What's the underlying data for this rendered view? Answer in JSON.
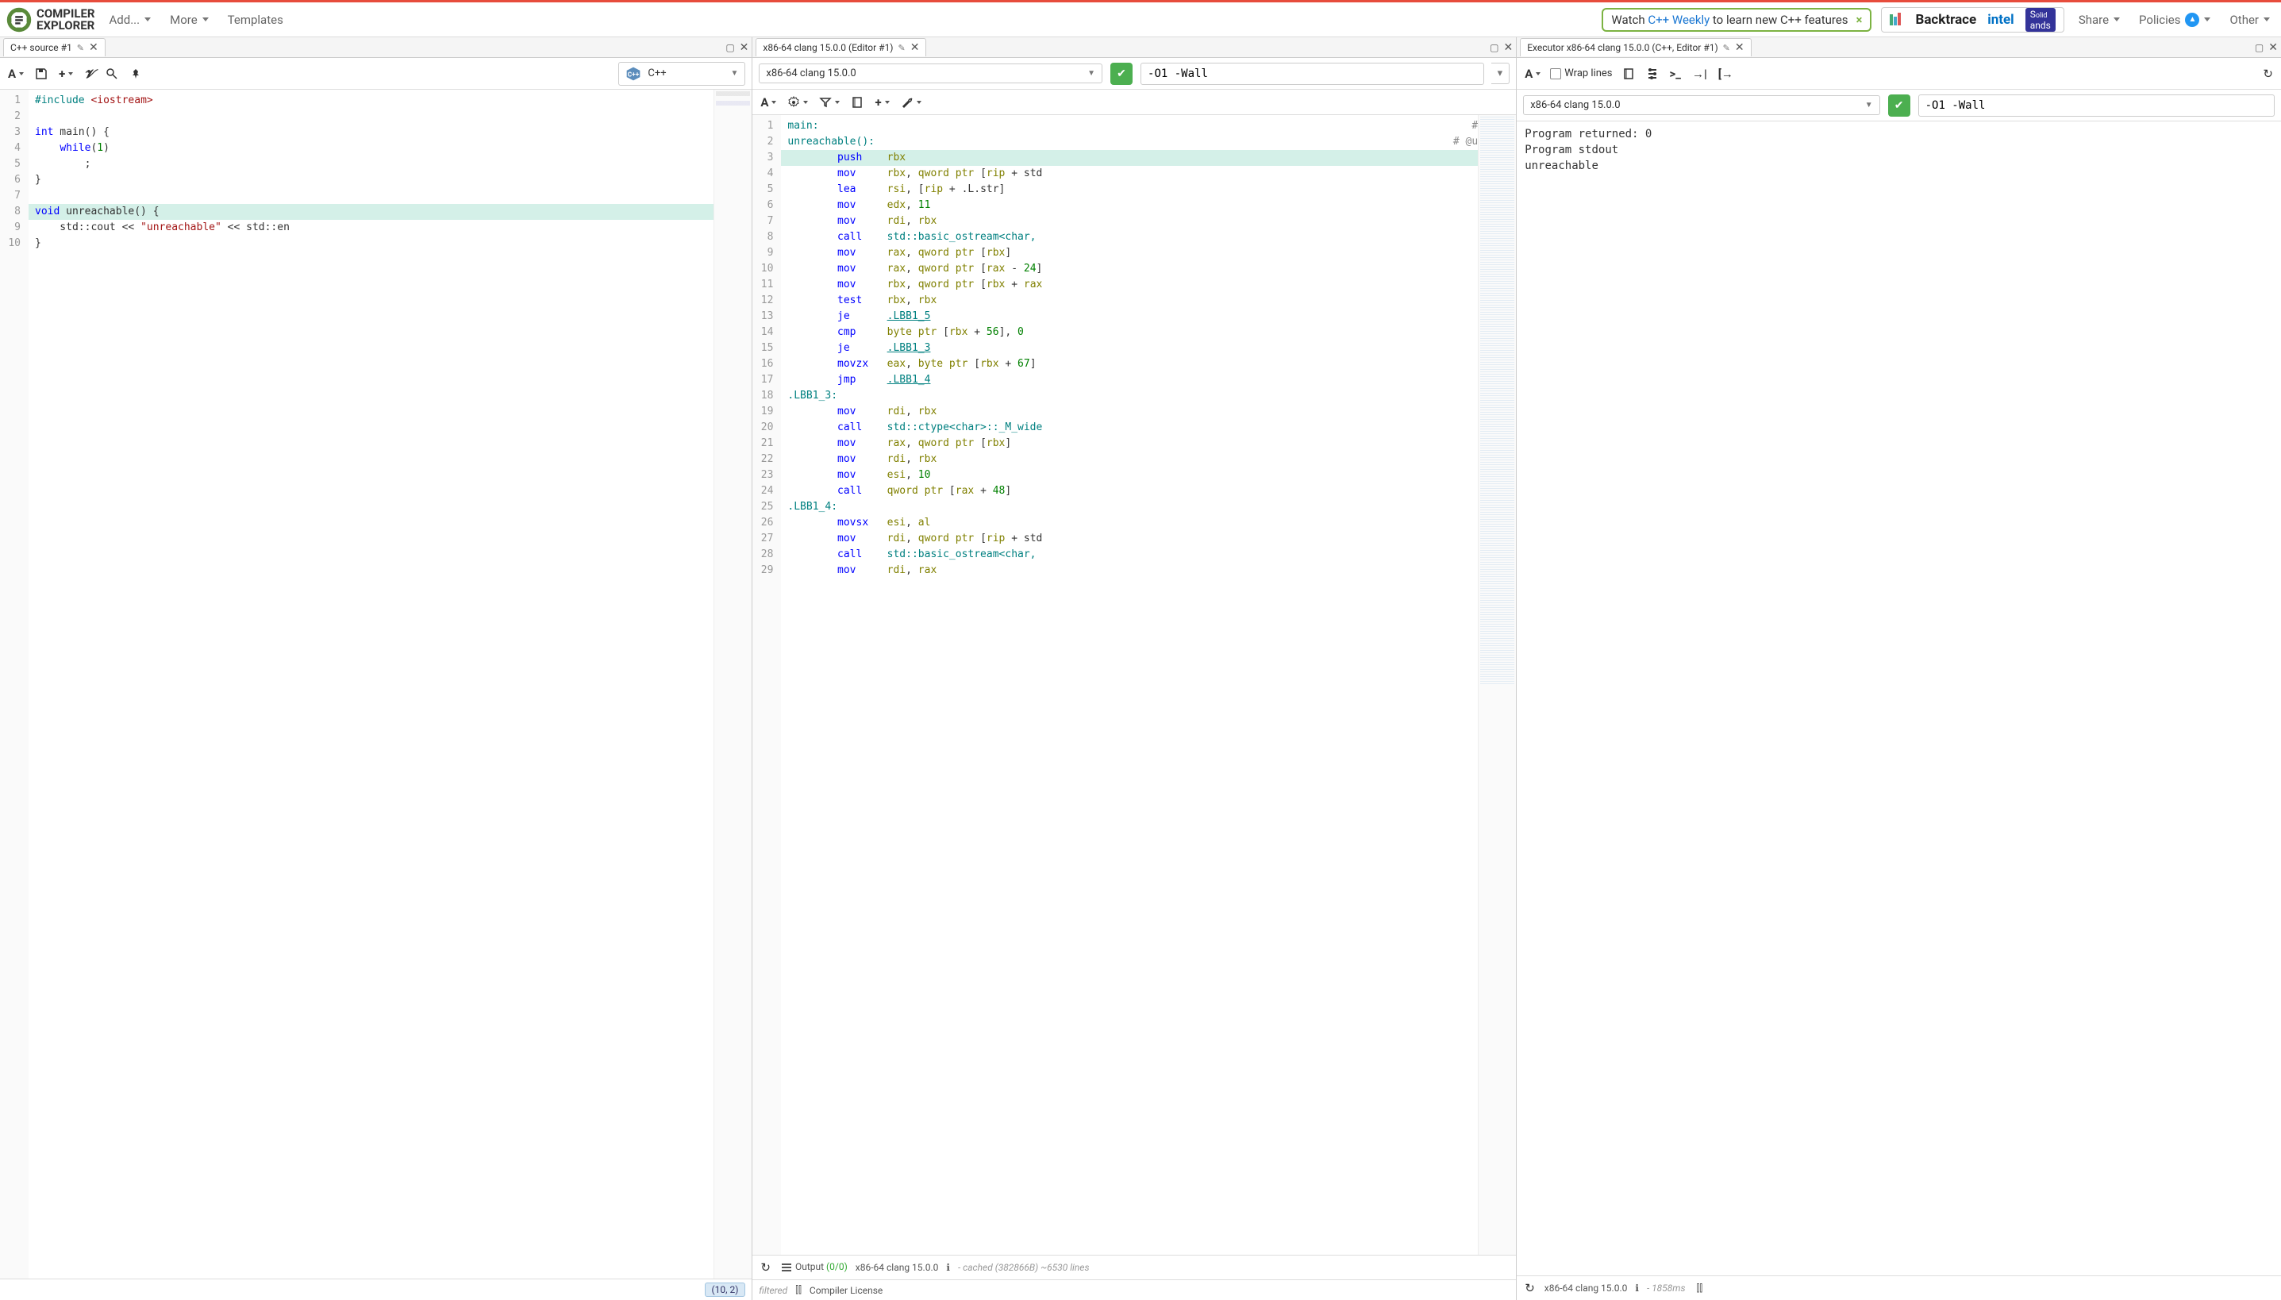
{
  "header": {
    "logo_top": "COMPILER",
    "logo_bot": "EXPLORER",
    "nav": {
      "add": "Add...",
      "more": "More",
      "templates": "Templates",
      "share": "Share",
      "policies": "Policies",
      "other": "Other"
    },
    "banner": {
      "prefix": "Watch ",
      "link": "C++ Weekly",
      "suffix": " to learn new C++ features"
    },
    "sponsors": {
      "backtrace": "Backtrace",
      "intel": "intel",
      "solidsands": "Solid Sands"
    }
  },
  "editor": {
    "tab": "C++ source #1",
    "lang_label": "C++",
    "cursor": "(10, 2)",
    "lines": [
      {
        "n": 1,
        "tokens": [
          {
            "t": "#include ",
            "c": "k-teal"
          },
          {
            "t": "<iostream>",
            "c": "k-str"
          }
        ]
      },
      {
        "n": 2,
        "tokens": []
      },
      {
        "n": 3,
        "tokens": [
          {
            "t": "int",
            "c": "k-blue"
          },
          {
            "t": " main() {",
            "c": ""
          }
        ]
      },
      {
        "n": 4,
        "tokens": [
          {
            "t": "    ",
            "c": ""
          },
          {
            "t": "while",
            "c": "k-blue"
          },
          {
            "t": "(",
            "c": ""
          },
          {
            "t": "1",
            "c": "k-green"
          },
          {
            "t": ")",
            "c": ""
          }
        ]
      },
      {
        "n": 5,
        "tokens": [
          {
            "t": "        ;",
            "c": ""
          }
        ]
      },
      {
        "n": 6,
        "tokens": [
          {
            "t": "}",
            "c": ""
          }
        ]
      },
      {
        "n": 7,
        "tokens": []
      },
      {
        "n": 8,
        "hl": true,
        "tokens": [
          {
            "t": "void",
            "c": "k-blue"
          },
          {
            "t": " unreachable() {",
            "c": ""
          }
        ]
      },
      {
        "n": 9,
        "tokens": [
          {
            "t": "    std::cout << ",
            "c": ""
          },
          {
            "t": "\"unreachable\"",
            "c": "k-str"
          },
          {
            "t": " << std::en",
            "c": ""
          }
        ]
      },
      {
        "n": 10,
        "tokens": [
          {
            "t": "}",
            "c": ""
          }
        ]
      }
    ]
  },
  "compiler": {
    "tab": "x86-64 clang 15.0.0 (Editor #1)",
    "compiler_label": "x86-64 clang 15.0.0",
    "opts": "-O1 -Wall",
    "asm": [
      {
        "n": 1,
        "ind": 0,
        "tokens": [
          {
            "t": "main:",
            "c": "k-teal"
          }
        ],
        "right": "#"
      },
      {
        "n": 2,
        "ind": 0,
        "tokens": [
          {
            "t": "unreachable():",
            "c": "k-teal"
          }
        ],
        "right": "# @u"
      },
      {
        "n": 3,
        "ind": 2,
        "hl": true,
        "tokens": [
          {
            "t": "push",
            "c": "k-blue"
          },
          {
            "t": "    ",
            "c": ""
          },
          {
            "t": "rbx",
            "c": "k-olive"
          }
        ]
      },
      {
        "n": 4,
        "ind": 2,
        "tokens": [
          {
            "t": "mov",
            "c": "k-blue"
          },
          {
            "t": "     ",
            "c": ""
          },
          {
            "t": "rbx",
            "c": "k-olive"
          },
          {
            "t": ", ",
            "c": ""
          },
          {
            "t": "qword ptr",
            "c": "k-olive"
          },
          {
            "t": " [",
            "c": ""
          },
          {
            "t": "rip",
            "c": "k-olive"
          },
          {
            "t": " + std",
            "c": ""
          }
        ]
      },
      {
        "n": 5,
        "ind": 2,
        "tokens": [
          {
            "t": "lea",
            "c": "k-blue"
          },
          {
            "t": "     ",
            "c": ""
          },
          {
            "t": "rsi",
            "c": "k-olive"
          },
          {
            "t": ", [",
            "c": ""
          },
          {
            "t": "rip",
            "c": "k-olive"
          },
          {
            "t": " + .L.str]",
            "c": ""
          }
        ]
      },
      {
        "n": 6,
        "ind": 2,
        "tokens": [
          {
            "t": "mov",
            "c": "k-blue"
          },
          {
            "t": "     ",
            "c": ""
          },
          {
            "t": "edx",
            "c": "k-olive"
          },
          {
            "t": ", ",
            "c": ""
          },
          {
            "t": "11",
            "c": "k-green"
          }
        ]
      },
      {
        "n": 7,
        "ind": 2,
        "tokens": [
          {
            "t": "mov",
            "c": "k-blue"
          },
          {
            "t": "     ",
            "c": ""
          },
          {
            "t": "rdi",
            "c": "k-olive"
          },
          {
            "t": ", ",
            "c": ""
          },
          {
            "t": "rbx",
            "c": "k-olive"
          }
        ]
      },
      {
        "n": 8,
        "ind": 2,
        "tokens": [
          {
            "t": "call",
            "c": "k-blue"
          },
          {
            "t": "    ",
            "c": ""
          },
          {
            "t": "std::basic_ostream<char, ",
            "c": "k-teal"
          }
        ]
      },
      {
        "n": 9,
        "ind": 2,
        "tokens": [
          {
            "t": "mov",
            "c": "k-blue"
          },
          {
            "t": "     ",
            "c": ""
          },
          {
            "t": "rax",
            "c": "k-olive"
          },
          {
            "t": ", ",
            "c": ""
          },
          {
            "t": "qword ptr",
            "c": "k-olive"
          },
          {
            "t": " [",
            "c": ""
          },
          {
            "t": "rbx",
            "c": "k-olive"
          },
          {
            "t": "]",
            "c": ""
          }
        ]
      },
      {
        "n": 10,
        "ind": 2,
        "tokens": [
          {
            "t": "mov",
            "c": "k-blue"
          },
          {
            "t": "     ",
            "c": ""
          },
          {
            "t": "rax",
            "c": "k-olive"
          },
          {
            "t": ", ",
            "c": ""
          },
          {
            "t": "qword ptr",
            "c": "k-olive"
          },
          {
            "t": " [",
            "c": ""
          },
          {
            "t": "rax",
            "c": "k-olive"
          },
          {
            "t": " - ",
            "c": ""
          },
          {
            "t": "24",
            "c": "k-green"
          },
          {
            "t": "]",
            "c": ""
          }
        ]
      },
      {
        "n": 11,
        "ind": 2,
        "tokens": [
          {
            "t": "mov",
            "c": "k-blue"
          },
          {
            "t": "     ",
            "c": ""
          },
          {
            "t": "rbx",
            "c": "k-olive"
          },
          {
            "t": ", ",
            "c": ""
          },
          {
            "t": "qword ptr",
            "c": "k-olive"
          },
          {
            "t": " [",
            "c": ""
          },
          {
            "t": "rbx",
            "c": "k-olive"
          },
          {
            "t": " + ",
            "c": ""
          },
          {
            "t": "rax",
            "c": "k-olive"
          }
        ]
      },
      {
        "n": 12,
        "ind": 2,
        "tokens": [
          {
            "t": "test",
            "c": "k-blue"
          },
          {
            "t": "    ",
            "c": ""
          },
          {
            "t": "rbx",
            "c": "k-olive"
          },
          {
            "t": ", ",
            "c": ""
          },
          {
            "t": "rbx",
            "c": "k-olive"
          }
        ]
      },
      {
        "n": 13,
        "ind": 2,
        "tokens": [
          {
            "t": "je",
            "c": "k-blue"
          },
          {
            "t": "      ",
            "c": ""
          },
          {
            "t": ".LBB1_5",
            "c": "k-teal k-und"
          }
        ]
      },
      {
        "n": 14,
        "ind": 2,
        "tokens": [
          {
            "t": "cmp",
            "c": "k-blue"
          },
          {
            "t": "     ",
            "c": ""
          },
          {
            "t": "byte ptr",
            "c": "k-olive"
          },
          {
            "t": " [",
            "c": ""
          },
          {
            "t": "rbx",
            "c": "k-olive"
          },
          {
            "t": " + ",
            "c": ""
          },
          {
            "t": "56",
            "c": "k-green"
          },
          {
            "t": "], ",
            "c": ""
          },
          {
            "t": "0",
            "c": "k-green"
          }
        ]
      },
      {
        "n": 15,
        "ind": 2,
        "tokens": [
          {
            "t": "je",
            "c": "k-blue"
          },
          {
            "t": "      ",
            "c": ""
          },
          {
            "t": ".LBB1_3",
            "c": "k-teal k-und"
          }
        ]
      },
      {
        "n": 16,
        "ind": 2,
        "tokens": [
          {
            "t": "movzx",
            "c": "k-blue"
          },
          {
            "t": "   ",
            "c": ""
          },
          {
            "t": "eax",
            "c": "k-olive"
          },
          {
            "t": ", ",
            "c": ""
          },
          {
            "t": "byte ptr",
            "c": "k-olive"
          },
          {
            "t": " [",
            "c": ""
          },
          {
            "t": "rbx",
            "c": "k-olive"
          },
          {
            "t": " + ",
            "c": ""
          },
          {
            "t": "67",
            "c": "k-green"
          },
          {
            "t": "]",
            "c": ""
          }
        ]
      },
      {
        "n": 17,
        "ind": 2,
        "tokens": [
          {
            "t": "jmp",
            "c": "k-blue"
          },
          {
            "t": "     ",
            "c": ""
          },
          {
            "t": ".LBB1_4",
            "c": "k-teal k-und"
          }
        ]
      },
      {
        "n": 18,
        "ind": 0,
        "tokens": [
          {
            "t": ".LBB1_3:",
            "c": "k-teal"
          }
        ]
      },
      {
        "n": 19,
        "ind": 2,
        "tokens": [
          {
            "t": "mov",
            "c": "k-blue"
          },
          {
            "t": "     ",
            "c": ""
          },
          {
            "t": "rdi",
            "c": "k-olive"
          },
          {
            "t": ", ",
            "c": ""
          },
          {
            "t": "rbx",
            "c": "k-olive"
          }
        ]
      },
      {
        "n": 20,
        "ind": 2,
        "tokens": [
          {
            "t": "call",
            "c": "k-blue"
          },
          {
            "t": "    ",
            "c": ""
          },
          {
            "t": "std::ctype<char>::_M_wide",
            "c": "k-teal"
          }
        ]
      },
      {
        "n": 21,
        "ind": 2,
        "tokens": [
          {
            "t": "mov",
            "c": "k-blue"
          },
          {
            "t": "     ",
            "c": ""
          },
          {
            "t": "rax",
            "c": "k-olive"
          },
          {
            "t": ", ",
            "c": ""
          },
          {
            "t": "qword ptr",
            "c": "k-olive"
          },
          {
            "t": " [",
            "c": ""
          },
          {
            "t": "rbx",
            "c": "k-olive"
          },
          {
            "t": "]",
            "c": ""
          }
        ]
      },
      {
        "n": 22,
        "ind": 2,
        "tokens": [
          {
            "t": "mov",
            "c": "k-blue"
          },
          {
            "t": "     ",
            "c": ""
          },
          {
            "t": "rdi",
            "c": "k-olive"
          },
          {
            "t": ", ",
            "c": ""
          },
          {
            "t": "rbx",
            "c": "k-olive"
          }
        ]
      },
      {
        "n": 23,
        "ind": 2,
        "tokens": [
          {
            "t": "mov",
            "c": "k-blue"
          },
          {
            "t": "     ",
            "c": ""
          },
          {
            "t": "esi",
            "c": "k-olive"
          },
          {
            "t": ", ",
            "c": ""
          },
          {
            "t": "10",
            "c": "k-green"
          }
        ]
      },
      {
        "n": 24,
        "ind": 2,
        "tokens": [
          {
            "t": "call",
            "c": "k-blue"
          },
          {
            "t": "    ",
            "c": ""
          },
          {
            "t": "qword ptr",
            "c": "k-olive"
          },
          {
            "t": " [",
            "c": ""
          },
          {
            "t": "rax",
            "c": "k-olive"
          },
          {
            "t": " + ",
            "c": ""
          },
          {
            "t": "48",
            "c": "k-green"
          },
          {
            "t": "]",
            "c": ""
          }
        ]
      },
      {
        "n": 25,
        "ind": 0,
        "tokens": [
          {
            "t": ".LBB1_4:",
            "c": "k-teal"
          }
        ]
      },
      {
        "n": 26,
        "ind": 2,
        "tokens": [
          {
            "t": "movsx",
            "c": "k-blue"
          },
          {
            "t": "   ",
            "c": ""
          },
          {
            "t": "esi",
            "c": "k-olive"
          },
          {
            "t": ", ",
            "c": ""
          },
          {
            "t": "al",
            "c": "k-olive"
          }
        ]
      },
      {
        "n": 27,
        "ind": 2,
        "tokens": [
          {
            "t": "mov",
            "c": "k-blue"
          },
          {
            "t": "     ",
            "c": ""
          },
          {
            "t": "rdi",
            "c": "k-olive"
          },
          {
            "t": ", ",
            "c": ""
          },
          {
            "t": "qword ptr",
            "c": "k-olive"
          },
          {
            "t": " [",
            "c": ""
          },
          {
            "t": "rip",
            "c": "k-olive"
          },
          {
            "t": " + std",
            "c": ""
          }
        ]
      },
      {
        "n": 28,
        "ind": 2,
        "tokens": [
          {
            "t": "call",
            "c": "k-blue"
          },
          {
            "t": "    ",
            "c": ""
          },
          {
            "t": "std::basic_ostream<char, ",
            "c": "k-teal"
          }
        ]
      },
      {
        "n": 29,
        "ind": 2,
        "tokens": [
          {
            "t": "mov",
            "c": "k-blue"
          },
          {
            "t": "     ",
            "c": ""
          },
          {
            "t": "rdi",
            "c": "k-olive"
          },
          {
            "t": ", ",
            "c": ""
          },
          {
            "t": "rax",
            "c": "k-olive"
          }
        ]
      }
    ],
    "status": {
      "output_label": "Output",
      "output_counts": "(0/0)",
      "compiler": "x86-64 clang 15.0.0",
      "cache": "- cached (382866B) ~6530 lines",
      "filtered": "filtered",
      "license": "Compiler License"
    }
  },
  "executor": {
    "tab": "Executor x86-64 clang 15.0.0 (C++, Editor #1)",
    "wrap_label": "Wrap lines",
    "compiler_label": "x86-64 clang 15.0.0",
    "opts": "-O1 -Wall",
    "output": [
      "Program returned: 0",
      "Program stdout",
      "unreachable"
    ],
    "status": {
      "compiler": "x86-64 clang 15.0.0",
      "time": "- 1858ms"
    }
  }
}
